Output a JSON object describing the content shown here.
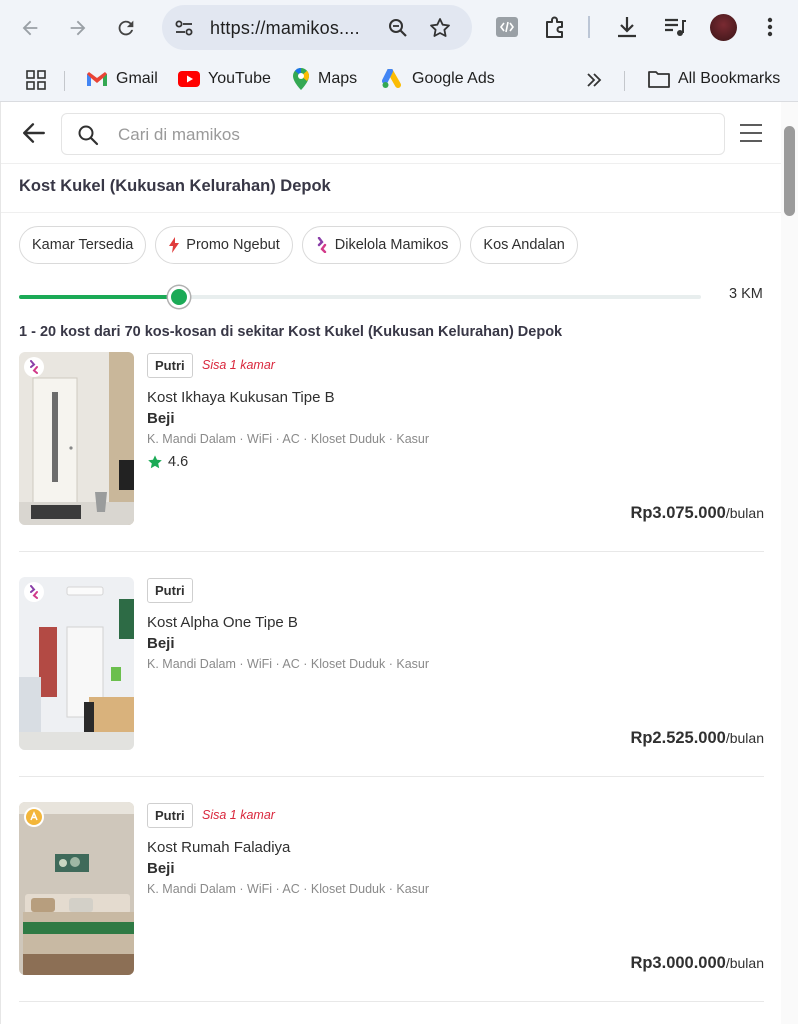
{
  "browser": {
    "url": "https://mamikos....",
    "bookmarks": [
      {
        "label": "Gmail",
        "icon": "gmail-icon"
      },
      {
        "label": "YouTube",
        "icon": "youtube-icon"
      },
      {
        "label": "Maps",
        "icon": "maps-icon"
      },
      {
        "label": "Google Ads",
        "icon": "google-ads-icon"
      }
    ],
    "all_bookmarks_label": "All Bookmarks"
  },
  "search": {
    "placeholder": "Cari di mamikos"
  },
  "page_title": "Kost Kukel (Kukusan Kelurahan) Depok",
  "filters": [
    {
      "label": "Kamar Tersedia"
    },
    {
      "label": "Promo Ngebut"
    },
    {
      "label": "Dikelola Mamikos"
    },
    {
      "label": "Kos Andalan"
    }
  ],
  "radius": {
    "label": "3 KM",
    "fraction": 0.235
  },
  "result_count": "1 - 20 kost dari 70 kos-kosan di sekitar Kost Kukel (Kukusan Kelurahan) Depok",
  "listings": [
    {
      "gender": "Putri",
      "availability": "Sisa 1 kamar",
      "name": "Kost Ikhaya Kukusan Tipe B",
      "area": "Beji",
      "facilities": "K. Mandi Dalam · WiFi · AC · Kloset Duduk · Kasur",
      "rating": "4.6",
      "price": "Rp3.075.000",
      "price_unit": "/bulan"
    },
    {
      "gender": "Putri",
      "availability": "",
      "name": "Kost Alpha One Tipe B",
      "area": "Beji",
      "facilities": "K. Mandi Dalam · WiFi · AC · Kloset Duduk · Kasur",
      "rating": "",
      "price": "Rp2.525.000",
      "price_unit": "/bulan"
    },
    {
      "gender": "Putri",
      "availability": "Sisa 1 kamar",
      "name": "Kost Rumah Faladiya",
      "area": "Beji",
      "facilities": "K. Mandi Dalam · WiFi · AC · Kloset Duduk · Kasur",
      "rating": "",
      "price": "Rp3.000.000",
      "price_unit": "/bulan"
    }
  ],
  "colors": {
    "accent": "#1baa56",
    "availability": "#d9273d",
    "rating_star": "#1baa56"
  }
}
